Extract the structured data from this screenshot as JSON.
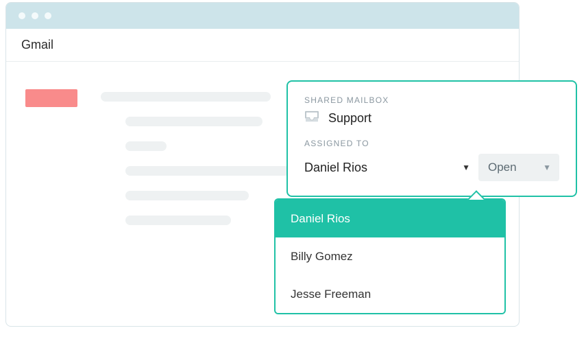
{
  "header": {
    "title": "Gmail"
  },
  "panel": {
    "mailbox_label": "SHARED MAILBOX",
    "mailbox_name": "Support",
    "assigned_label": "ASSIGNED TO",
    "assignee_selected": "Daniel Rios",
    "status_selected": "Open"
  },
  "assignee_options": {
    "item0": "Daniel Rios",
    "item1": "Billy Gomez",
    "item2": "Jesse Freeman"
  },
  "colors": {
    "accent": "#1fc1a6",
    "titlebar": "#cde4ea",
    "red_block": "#f98b8b"
  }
}
